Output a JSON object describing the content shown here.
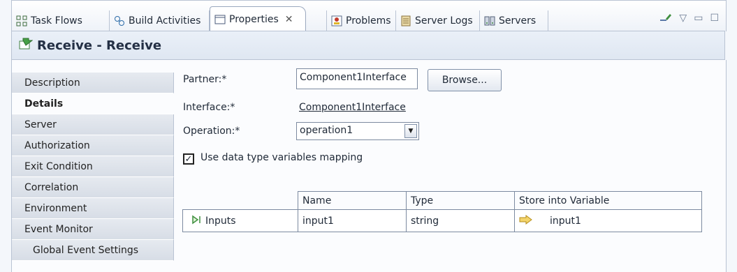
{
  "tabs": [
    {
      "label": "Task Flows",
      "icon": "task-flows-icon"
    },
    {
      "label": "Build Activities",
      "icon": "build-activities-icon"
    },
    {
      "label": "Properties",
      "icon": "properties-icon",
      "active": true
    },
    {
      "label": "Problems",
      "icon": "problems-icon"
    },
    {
      "label": "Server Logs",
      "icon": "server-logs-icon"
    },
    {
      "label": "Servers",
      "icon": "servers-icon"
    }
  ],
  "title": "Receive - Receive",
  "sidebar": {
    "items": [
      {
        "label": "Description"
      },
      {
        "label": "Details",
        "selected": true
      },
      {
        "label": "Server"
      },
      {
        "label": "Authorization"
      },
      {
        "label": "Exit Condition"
      },
      {
        "label": "Correlation"
      },
      {
        "label": "Environment"
      },
      {
        "label": "Event Monitor"
      },
      {
        "label": "Global Event Settings",
        "indent": true
      }
    ]
  },
  "form": {
    "partner_label": "Partner:*",
    "partner_value": "Component1Interface",
    "browse_label": "Browse...",
    "interface_label": "Interface:*",
    "interface_value": "Component1Interface",
    "operation_label": "Operation:*",
    "operation_value": "operation1",
    "checkbox_label": "Use data type variables mapping",
    "checkbox_checked": true
  },
  "table": {
    "columns": [
      "Name",
      "Type",
      "Store into Variable"
    ],
    "rows": [
      {
        "label": "Inputs",
        "name": "input1",
        "type": "string",
        "variable": "input1"
      }
    ]
  },
  "colors": {
    "accent": "#3a66b0",
    "arrow": "#e0b52a",
    "inputs_icon": "#3f8f3f"
  }
}
